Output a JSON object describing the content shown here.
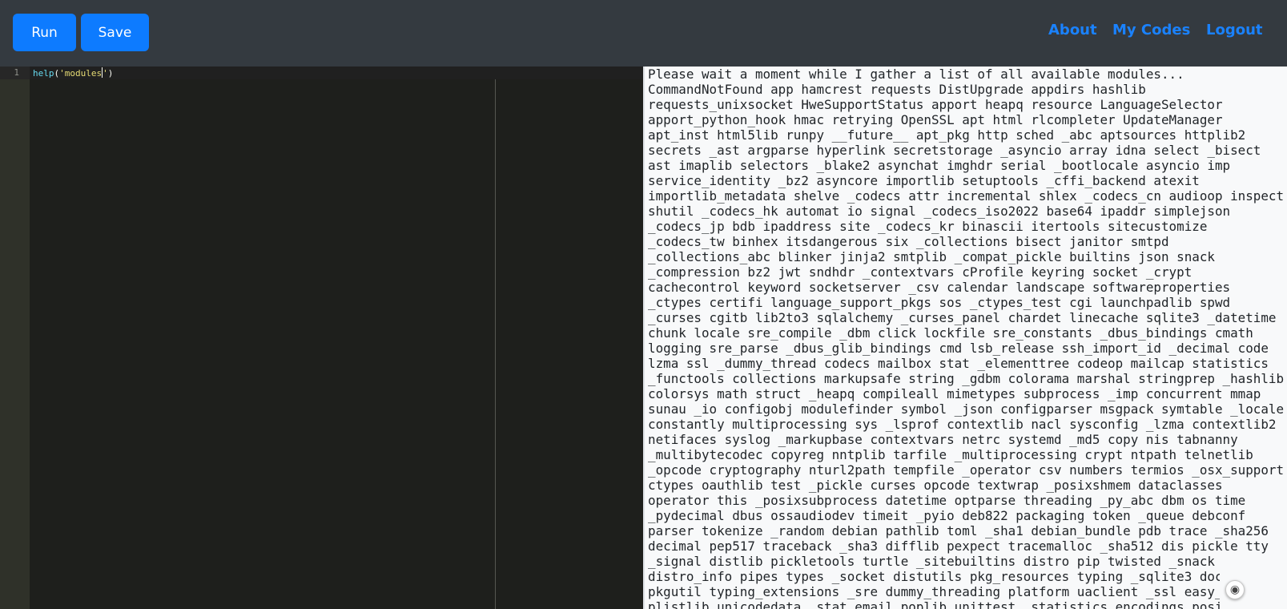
{
  "toolbar": {
    "run_label": "Run",
    "save_label": "Save"
  },
  "nav": {
    "about": "About",
    "my_codes": "My Codes",
    "logout": "Logout"
  },
  "editor": {
    "line_number": "1",
    "code": {
      "fn": "help",
      "open_paren": "(",
      "string_before_cursor": "'modules",
      "string_after_cursor": "'",
      "close_paren": ")"
    }
  },
  "output": {
    "lines": [
      "Please wait a moment while I gather a list of all available modules...",
      "CommandNotFound app hamcrest requests DistUpgrade appdirs hashlib",
      "requests_unixsocket HweSupportStatus apport heapq resource LanguageSelector",
      "apport_python_hook hmac retrying OpenSSL apt html rlcompleter UpdateManager",
      "apt_inst html5lib runpy __future__ apt_pkg http sched _abc aptsources httplib2",
      "secrets _ast argparse hyperlink secretstorage _asyncio array idna select _bisect",
      "ast imaplib selectors _blake2 asynchat imghdr serial _bootlocale asyncio imp",
      "service_identity _bz2 asyncore importlib setuptools _cffi_backend atexit",
      "importlib_metadata shelve _codecs attr incremental shlex _codecs_cn audioop inspect",
      "shutil _codecs_hk automat io signal _codecs_iso2022 base64 ipaddr simplejson",
      "_codecs_jp bdb ipaddress site _codecs_kr binascii itertools sitecustomize",
      "_codecs_tw binhex itsdangerous six _collections bisect janitor smtpd",
      "_collections_abc blinker jinja2 smtplib _compat_pickle builtins json snack",
      "_compression bz2 jwt sndhdr _contextvars cProfile keyring socket _crypt",
      "cachecontrol keyword socketserver _csv calendar landscape softwareproperties",
      "_ctypes certifi language_support_pkgs sos _ctypes_test cgi launchpadlib spwd",
      "_curses cgitb lib2to3 sqlalchemy _curses_panel chardet linecache sqlite3 _datetime",
      "chunk locale sre_compile _dbm click lockfile sre_constants _dbus_bindings cmath",
      "logging sre_parse _dbus_glib_bindings cmd lsb_release ssh_import_id _decimal code",
      "lzma ssl _dummy_thread codecs mailbox stat _elementtree codeop mailcap statistics",
      "_functools collections markupsafe string _gdbm colorama marshal stringprep _hashlib",
      "colorsys math struct _heapq compileall mimetypes subprocess _imp concurrent mmap",
      "sunau _io configobj modulefinder symbol _json configparser msgpack symtable _locale",
      "constantly multiprocessing sys _lsprof contextlib nacl sysconfig _lzma contextlib2",
      "netifaces syslog _markupbase contextvars netrc systemd _md5 copy nis tabnanny",
      "_multibytecodec copyreg nntplib tarfile _multiprocessing crypt ntpath telnetlib",
      "_opcode cryptography nturl2path tempfile _operator csv numbers termios _osx_support",
      "ctypes oauthlib test _pickle curses opcode textwrap _posixshmem dataclasses",
      "operator this _posixsubprocess datetime optparse threading _py_abc dbm os time",
      "_pydecimal dbus ossaudiodev timeit _pyio deb822 packaging token _queue debconf",
      "parser tokenize _random debian pathlib toml _sha1 debian_bundle pdb trace _sha256",
      "decimal pep517 traceback _sha3 difflib pexpect tracemalloc _sha512 dis pickle tty",
      "_signal distlib pickletools turtle _sitebuiltins distro pip twisted _snack",
      "distro_info pipes types _socket distutils pkg_resources typing _sqlite3 doc",
      "pkgutil typing_extensions _sre dummy_threading platform uaclient _ssl easy_",
      "plistlib unicodedata _stat email poplib unittest _statistics encodings posi"
    ]
  },
  "scroll_button": {
    "icon": "record-icon",
    "glyph": "◉"
  },
  "colors": {
    "topbar": "#343a40",
    "button": "#0d7bff",
    "nav_link": "#1a82ff",
    "editor_bg": "#1e1f1c",
    "gutter_bg": "#2f3129",
    "output_bg": "#f8f9fa"
  }
}
